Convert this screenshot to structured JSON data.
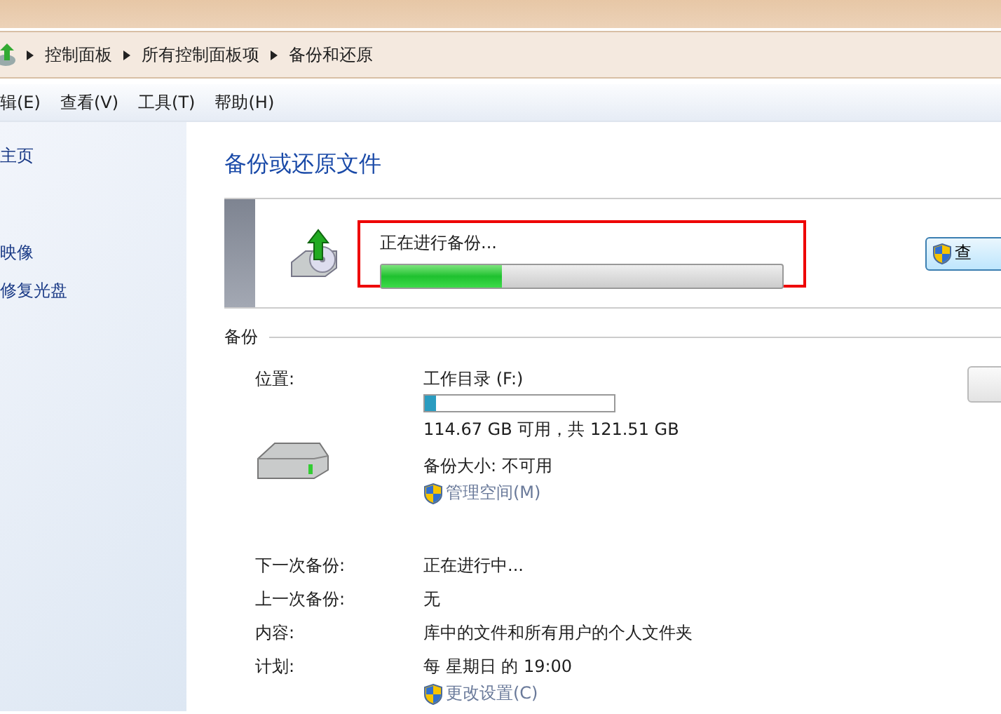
{
  "breadcrumb": [
    "控制面板",
    "所有控制面板项",
    "备份和还原"
  ],
  "menu": [
    "辑(E)",
    "查看(V)",
    "工具(T)",
    "帮助(H)"
  ],
  "sidebar": {
    "items": [
      "主页",
      "映像",
      "修复光盘"
    ]
  },
  "page_title": "备份或还原文件",
  "status": {
    "message": "正在进行备份...",
    "level": 0.3,
    "button": "查"
  },
  "section_label": "备份",
  "location": {
    "label": "位置:",
    "drive": "工作目录 (F:)",
    "level": 0.06,
    "space": "114.67 GB 可用，共 121.51 GB",
    "size": "备份大小: 不可用",
    "link": "管理空间(M)"
  },
  "details": [
    {
      "label": "下一次备份:",
      "value": "正在进行中..."
    },
    {
      "label": "上一次备份:",
      "value": "无"
    },
    {
      "label": "内容:",
      "value": "库中的文件和所有用户的个人文件夹"
    },
    {
      "label": "计划:",
      "value": "每 星期日 的 19:00"
    }
  ],
  "settings_link": "更改设置(C)"
}
